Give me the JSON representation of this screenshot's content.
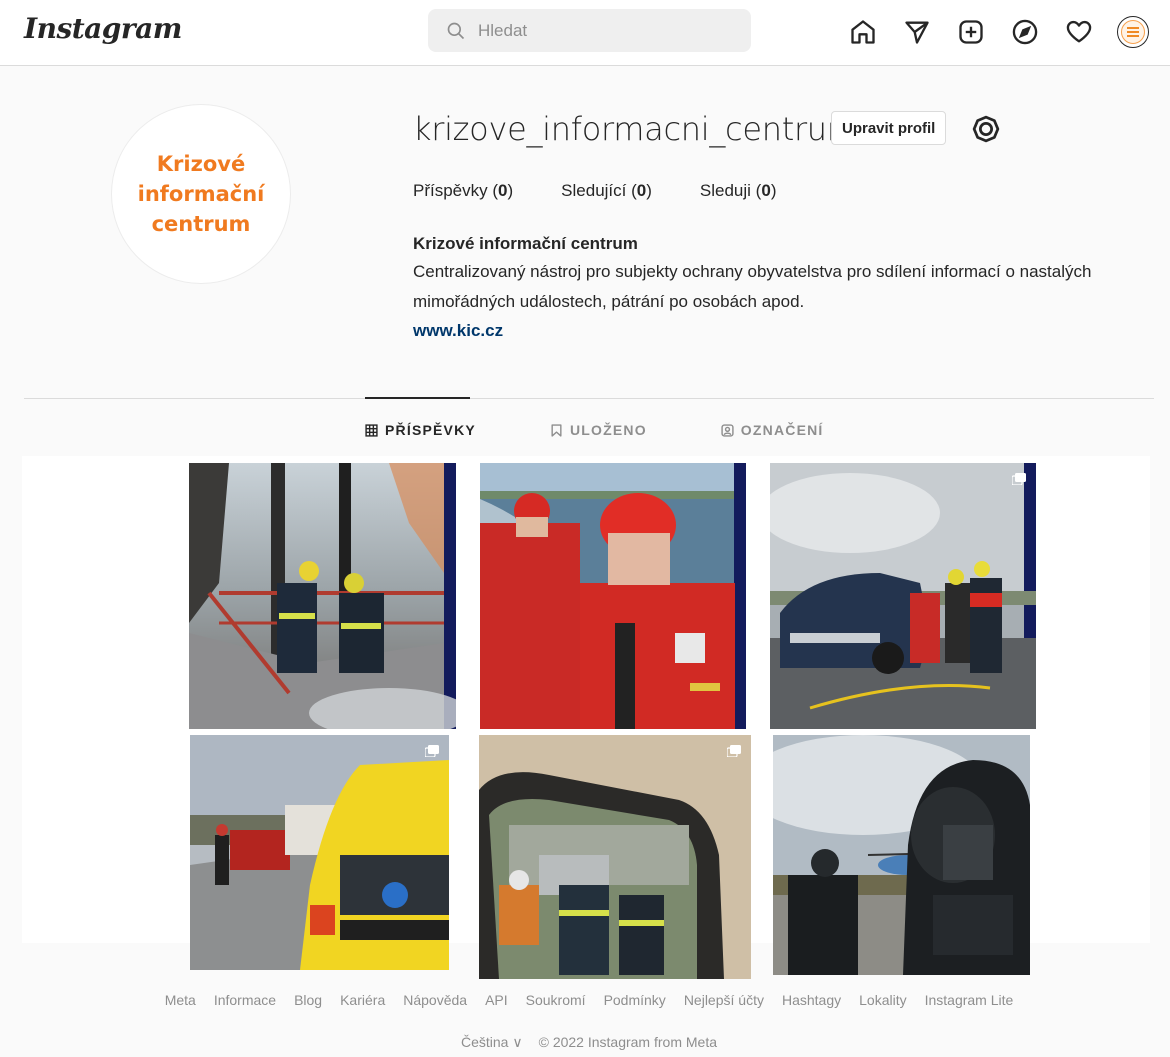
{
  "app": {
    "logo": "Instagram"
  },
  "search": {
    "placeholder": "Hledat"
  },
  "nav": {
    "icons": [
      "home-icon",
      "direct-icon",
      "new-post-icon",
      "explore-icon",
      "activity-icon",
      "profile-avatar"
    ]
  },
  "profile": {
    "avatar_text": [
      "Krizové",
      "informační",
      "centrum"
    ],
    "username": "krizove_informacni_centrum",
    "edit_button": "Upravit profil",
    "stats": [
      {
        "label": "Příspěvky",
        "value": "0"
      },
      {
        "label": "Sledující",
        "value": "0"
      },
      {
        "label": "Sleduji",
        "value": "0"
      }
    ],
    "full_name": "Krizové informační centrum",
    "bio": "Centralizovaný nástroj pro subjekty ochrany obyvatelstva pro sdílení informací o nastalých mimořádných událostech, pátrání po osobách apod.",
    "website": "www.kic.cz"
  },
  "tabs": [
    {
      "label": "PŘÍSPĚVKY",
      "icon": "grid-icon",
      "active": true
    },
    {
      "label": "ULOŽENO",
      "icon": "bookmark-icon",
      "active": false
    },
    {
      "label": "OZNAČENÍ",
      "icon": "tagged-icon",
      "active": false
    }
  ],
  "posts": [
    {
      "subject": "firefighters on burning stairs",
      "multi": false
    },
    {
      "subject": "water rescue crew in red suits",
      "multi": false
    },
    {
      "subject": "firefighters at crashed car",
      "multi": true
    },
    {
      "subject": "ambulance on highway",
      "multi": true
    },
    {
      "subject": "view through vehicle window",
      "multi": true
    },
    {
      "subject": "special forces with helicopter",
      "multi": false
    }
  ],
  "footer": {
    "links": [
      "Meta",
      "Informace",
      "Blog",
      "Kariéra",
      "Nápověda",
      "API",
      "Soukromí",
      "Podmínky",
      "Nejlepší účty",
      "Hashtagy",
      "Lokality",
      "Instagram Lite"
    ],
    "language": "Čeština",
    "copyright": "© 2022 Instagram from Meta"
  },
  "colors": {
    "accent_orange": "#f07a1f",
    "link": "#00376b",
    "border": "#dbdbdb",
    "muted": "#8e8e8e"
  }
}
